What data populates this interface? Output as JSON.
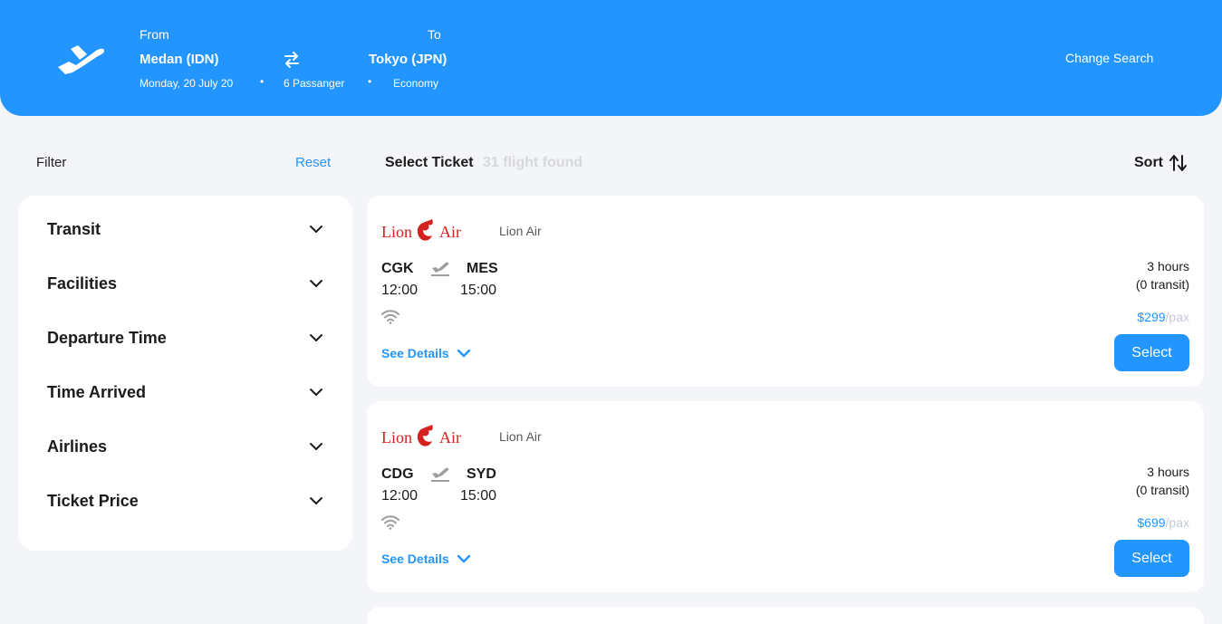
{
  "header": {
    "from_label": "From",
    "to_label": "To",
    "from_city": "Medan (IDN)",
    "to_city": "Tokyo (JPN)",
    "date": "Monday, 20 July 20",
    "passengers": "6 Passanger",
    "class": "Economy",
    "dot": "•",
    "change_search": "Change Search"
  },
  "filter": {
    "title": "Filter",
    "reset": "Reset",
    "items": [
      {
        "label": "Transit"
      },
      {
        "label": "Facilities"
      },
      {
        "label": "Departure Time"
      },
      {
        "label": "Time Arrived"
      },
      {
        "label": "Airlines"
      },
      {
        "label": "Ticket Price"
      }
    ]
  },
  "results": {
    "title": "Select Ticket",
    "count": "31 flight found",
    "sort": "Sort"
  },
  "tickets": [
    {
      "airline": "Lion Air",
      "logo_text": "Lion",
      "logo_text2": "Air",
      "from": "CGK",
      "to": "MES",
      "dep": "12:00",
      "arr": "15:00",
      "duration": "3 hours",
      "transit": "(0 transit)",
      "price": "$299",
      "per": "/pax",
      "details": "See Details",
      "select": "Select"
    },
    {
      "airline": "Lion Air",
      "logo_text": "Lion",
      "logo_text2": "Air",
      "from": "CDG",
      "to": "SYD",
      "dep": "12:00",
      "arr": "15:00",
      "duration": "3 hours",
      "transit": "(0 transit)",
      "price": "$699",
      "per": "/pax",
      "details": "See Details",
      "select": "Select"
    }
  ],
  "colors": {
    "accent": "#2395ff",
    "background": "#f4f5f9",
    "logo_red": "#d2231e"
  },
  "icons": [
    "plane-icon",
    "swap-icon",
    "chevron-down-icon",
    "sort-icon",
    "flight-takeoff-icon",
    "wifi-icon"
  ]
}
